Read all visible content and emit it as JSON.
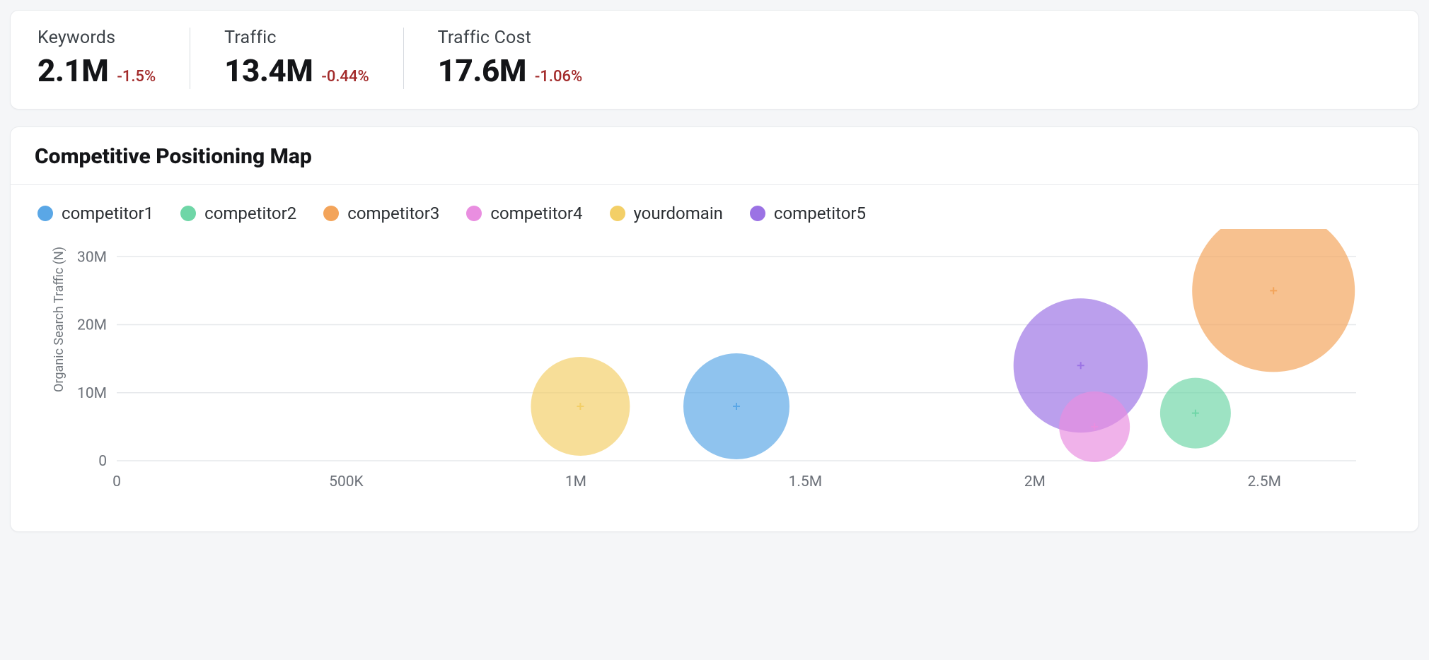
{
  "metrics": {
    "keywords": {
      "label": "Keywords",
      "value": "2.1M",
      "delta": "-1.5%"
    },
    "traffic": {
      "label": "Traffic",
      "value": "13.4M",
      "delta": "-0.44%"
    },
    "trafficCost": {
      "label": "Traffic Cost",
      "value": "17.6M",
      "delta": "-1.06%"
    }
  },
  "chart_section": {
    "title": "Competitive Positioning Map",
    "ylabel": "Organic Search Traffic (N)",
    "legend": [
      {
        "key": "competitor1",
        "label": "competitor1",
        "color": "#5aa7e6"
      },
      {
        "key": "competitor2",
        "label": "competitor2",
        "color": "#6fd6a7"
      },
      {
        "key": "competitor3",
        "label": "competitor3",
        "color": "#f3a45a"
      },
      {
        "key": "competitor4",
        "label": "competitor4",
        "color": "#e98ee0"
      },
      {
        "key": "yourdomain",
        "label": "yourdomain",
        "color": "#f3cf67"
      },
      {
        "key": "competitor5",
        "label": "competitor5",
        "color": "#9b72e4"
      }
    ]
  },
  "chart_data": {
    "type": "scatter",
    "subtype": "bubble",
    "title": "Competitive Positioning Map",
    "xlabel": "",
    "ylabel": "Organic Search Traffic (N)",
    "xlim": [
      0,
      2700000
    ],
    "ylim": [
      0,
      32000000
    ],
    "x_ticks": [
      0,
      500000,
      1000000,
      1500000,
      2000000,
      2500000
    ],
    "x_tick_labels": [
      "0",
      "500K",
      "1M",
      "1.5M",
      "2M",
      "2.5M"
    ],
    "y_ticks": [
      0,
      10000000,
      20000000,
      30000000
    ],
    "y_tick_labels": [
      "0",
      "10M",
      "20M",
      "30M"
    ],
    "series": [
      {
        "name": "competitor1",
        "color": "#5aa7e6",
        "x": 1350000,
        "y": 8000000,
        "size": 75
      },
      {
        "name": "competitor2",
        "color": "#6fd6a7",
        "x": 2350000,
        "y": 7000000,
        "size": 50
      },
      {
        "name": "competitor3",
        "color": "#f3a45a",
        "x": 2520000,
        "y": 25000000,
        "size": 115
      },
      {
        "name": "competitor4",
        "color": "#e98ee0",
        "x": 2130000,
        "y": 5000000,
        "size": 50
      },
      {
        "name": "yourdomain",
        "color": "#f3cf67",
        "x": 1010000,
        "y": 8000000,
        "size": 70
      },
      {
        "name": "competitor5",
        "color": "#9b72e4",
        "x": 2100000,
        "y": 14000000,
        "size": 95
      }
    ]
  }
}
